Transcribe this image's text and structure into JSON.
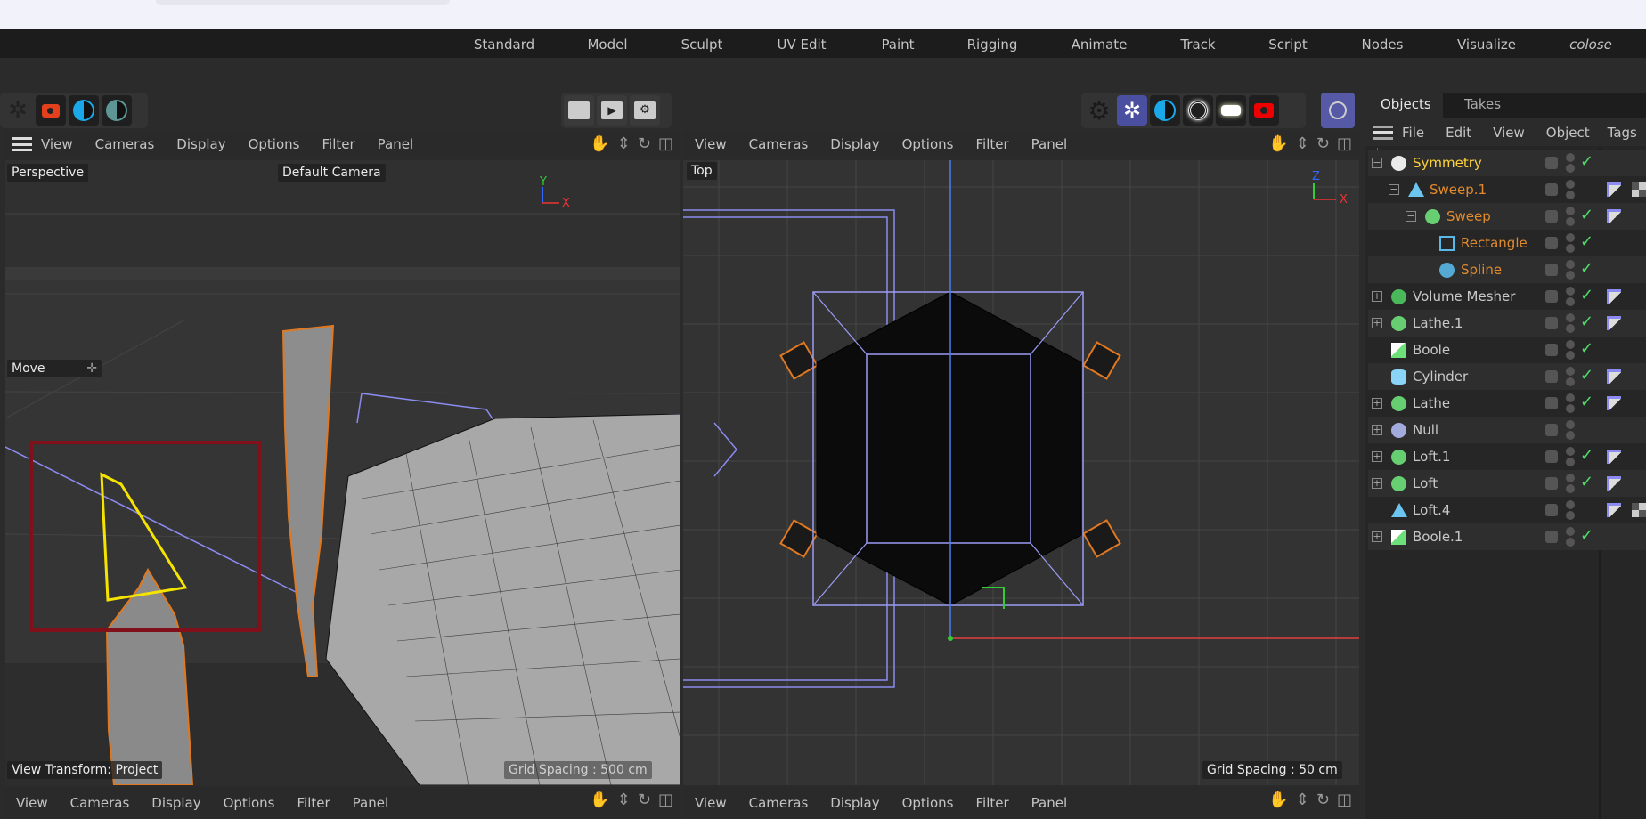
{
  "menubar": {
    "items": [
      "Standard",
      "Model",
      "Sculpt",
      "UV Edit",
      "Paint",
      "Rigging",
      "Animate",
      "Track",
      "Script",
      "Nodes",
      "Visualize",
      "colose"
    ]
  },
  "toolbar": {
    "left_icons": [
      "octane-icon",
      "render-camera-icon",
      "contrast-blue-icon",
      "contrast-gray-icon"
    ],
    "center_icons": [
      "render-view-icon",
      "render-active-icon",
      "render-settings-icon"
    ],
    "right_icons": [
      "gear-icon",
      "octane-live-icon",
      "contrast-icon",
      "target-light-icon",
      "area-light-icon",
      "camera-icon",
      "sky-dome-icon"
    ]
  },
  "viewport_menu": [
    "View",
    "Cameras",
    "Display",
    "Options",
    "Filter",
    "Panel"
  ],
  "viewport_left": {
    "name": "Perspective",
    "camera": "Default Camera",
    "tool": "Move",
    "view_transform": "View Transform: Project",
    "grid_spacing": "Grid Spacing : 500 cm"
  },
  "viewport_right": {
    "name": "Top",
    "grid_spacing": "Grid Spacing : 50 cm"
  },
  "objects_panel": {
    "tabs": [
      "Objects",
      "Takes"
    ],
    "menu": [
      "File",
      "Edit",
      "View",
      "Object",
      "Tags"
    ],
    "rows": [
      {
        "name": "Symmetry",
        "color": "#ffd23a",
        "level": 0,
        "expand": "-",
        "icon": "symmetry-icon",
        "check": true,
        "tags": []
      },
      {
        "name": "Sweep.1",
        "color": "#e08a2c",
        "level": 1,
        "expand": "-",
        "icon": "sweep-icon",
        "check": false,
        "tags": [
          "phong-tag",
          "checker-tag"
        ]
      },
      {
        "name": "Sweep",
        "color": "#e08a2c",
        "level": 2,
        "expand": "-",
        "icon": "sweep-spline-icon",
        "check": true,
        "tags": [
          "phong-tag"
        ]
      },
      {
        "name": "Rectangle",
        "color": "#e08a2c",
        "level": 3,
        "expand": "",
        "icon": "rectangle-icon",
        "check": true,
        "tags": []
      },
      {
        "name": "Spline",
        "color": "#e08a2c",
        "level": 3,
        "expand": "",
        "icon": "spline-icon",
        "check": true,
        "tags": []
      },
      {
        "name": "Volume Mesher",
        "color": "#c8c8c8",
        "level": 0,
        "expand": "+",
        "icon": "volume-mesher-icon",
        "check": true,
        "tags": [
          "phong-tag"
        ]
      },
      {
        "name": "Lathe.1",
        "color": "#c8c8c8",
        "level": 0,
        "expand": "+",
        "icon": "lathe-icon",
        "check": true,
        "tags": [
          "phong-tag"
        ]
      },
      {
        "name": "Boole",
        "color": "#c8c8c8",
        "level": 0,
        "expand": "",
        "icon": "boole-icon",
        "check": true,
        "tags": []
      },
      {
        "name": "Cylinder",
        "color": "#c8c8c8",
        "level": 0,
        "expand": "",
        "icon": "cylinder-icon",
        "check": true,
        "tags": [
          "phong-tag"
        ]
      },
      {
        "name": "Lathe",
        "color": "#c8c8c8",
        "level": 0,
        "expand": "+",
        "icon": "lathe-icon",
        "check": true,
        "tags": [
          "phong-tag"
        ]
      },
      {
        "name": "Null",
        "color": "#c8c8c8",
        "level": 0,
        "expand": "+",
        "icon": "null-icon",
        "check": false,
        "tags": []
      },
      {
        "name": "Loft.1",
        "color": "#c8c8c8",
        "level": 0,
        "expand": "+",
        "icon": "loft-icon",
        "check": true,
        "tags": [
          "phong-tag"
        ]
      },
      {
        "name": "Loft",
        "color": "#c8c8c8",
        "level": 0,
        "expand": "+",
        "icon": "loft-icon",
        "check": true,
        "tags": [
          "phong-tag"
        ]
      },
      {
        "name": "Loft.4",
        "color": "#c8c8c8",
        "level": 0,
        "expand": "",
        "icon": "sweep-icon",
        "check": false,
        "tags": [
          "phong-tag",
          "checker-tag"
        ]
      },
      {
        "name": "Boole.1",
        "color": "#c8c8c8",
        "level": 0,
        "expand": "+",
        "icon": "boole-icon",
        "check": true,
        "tags": []
      }
    ]
  }
}
